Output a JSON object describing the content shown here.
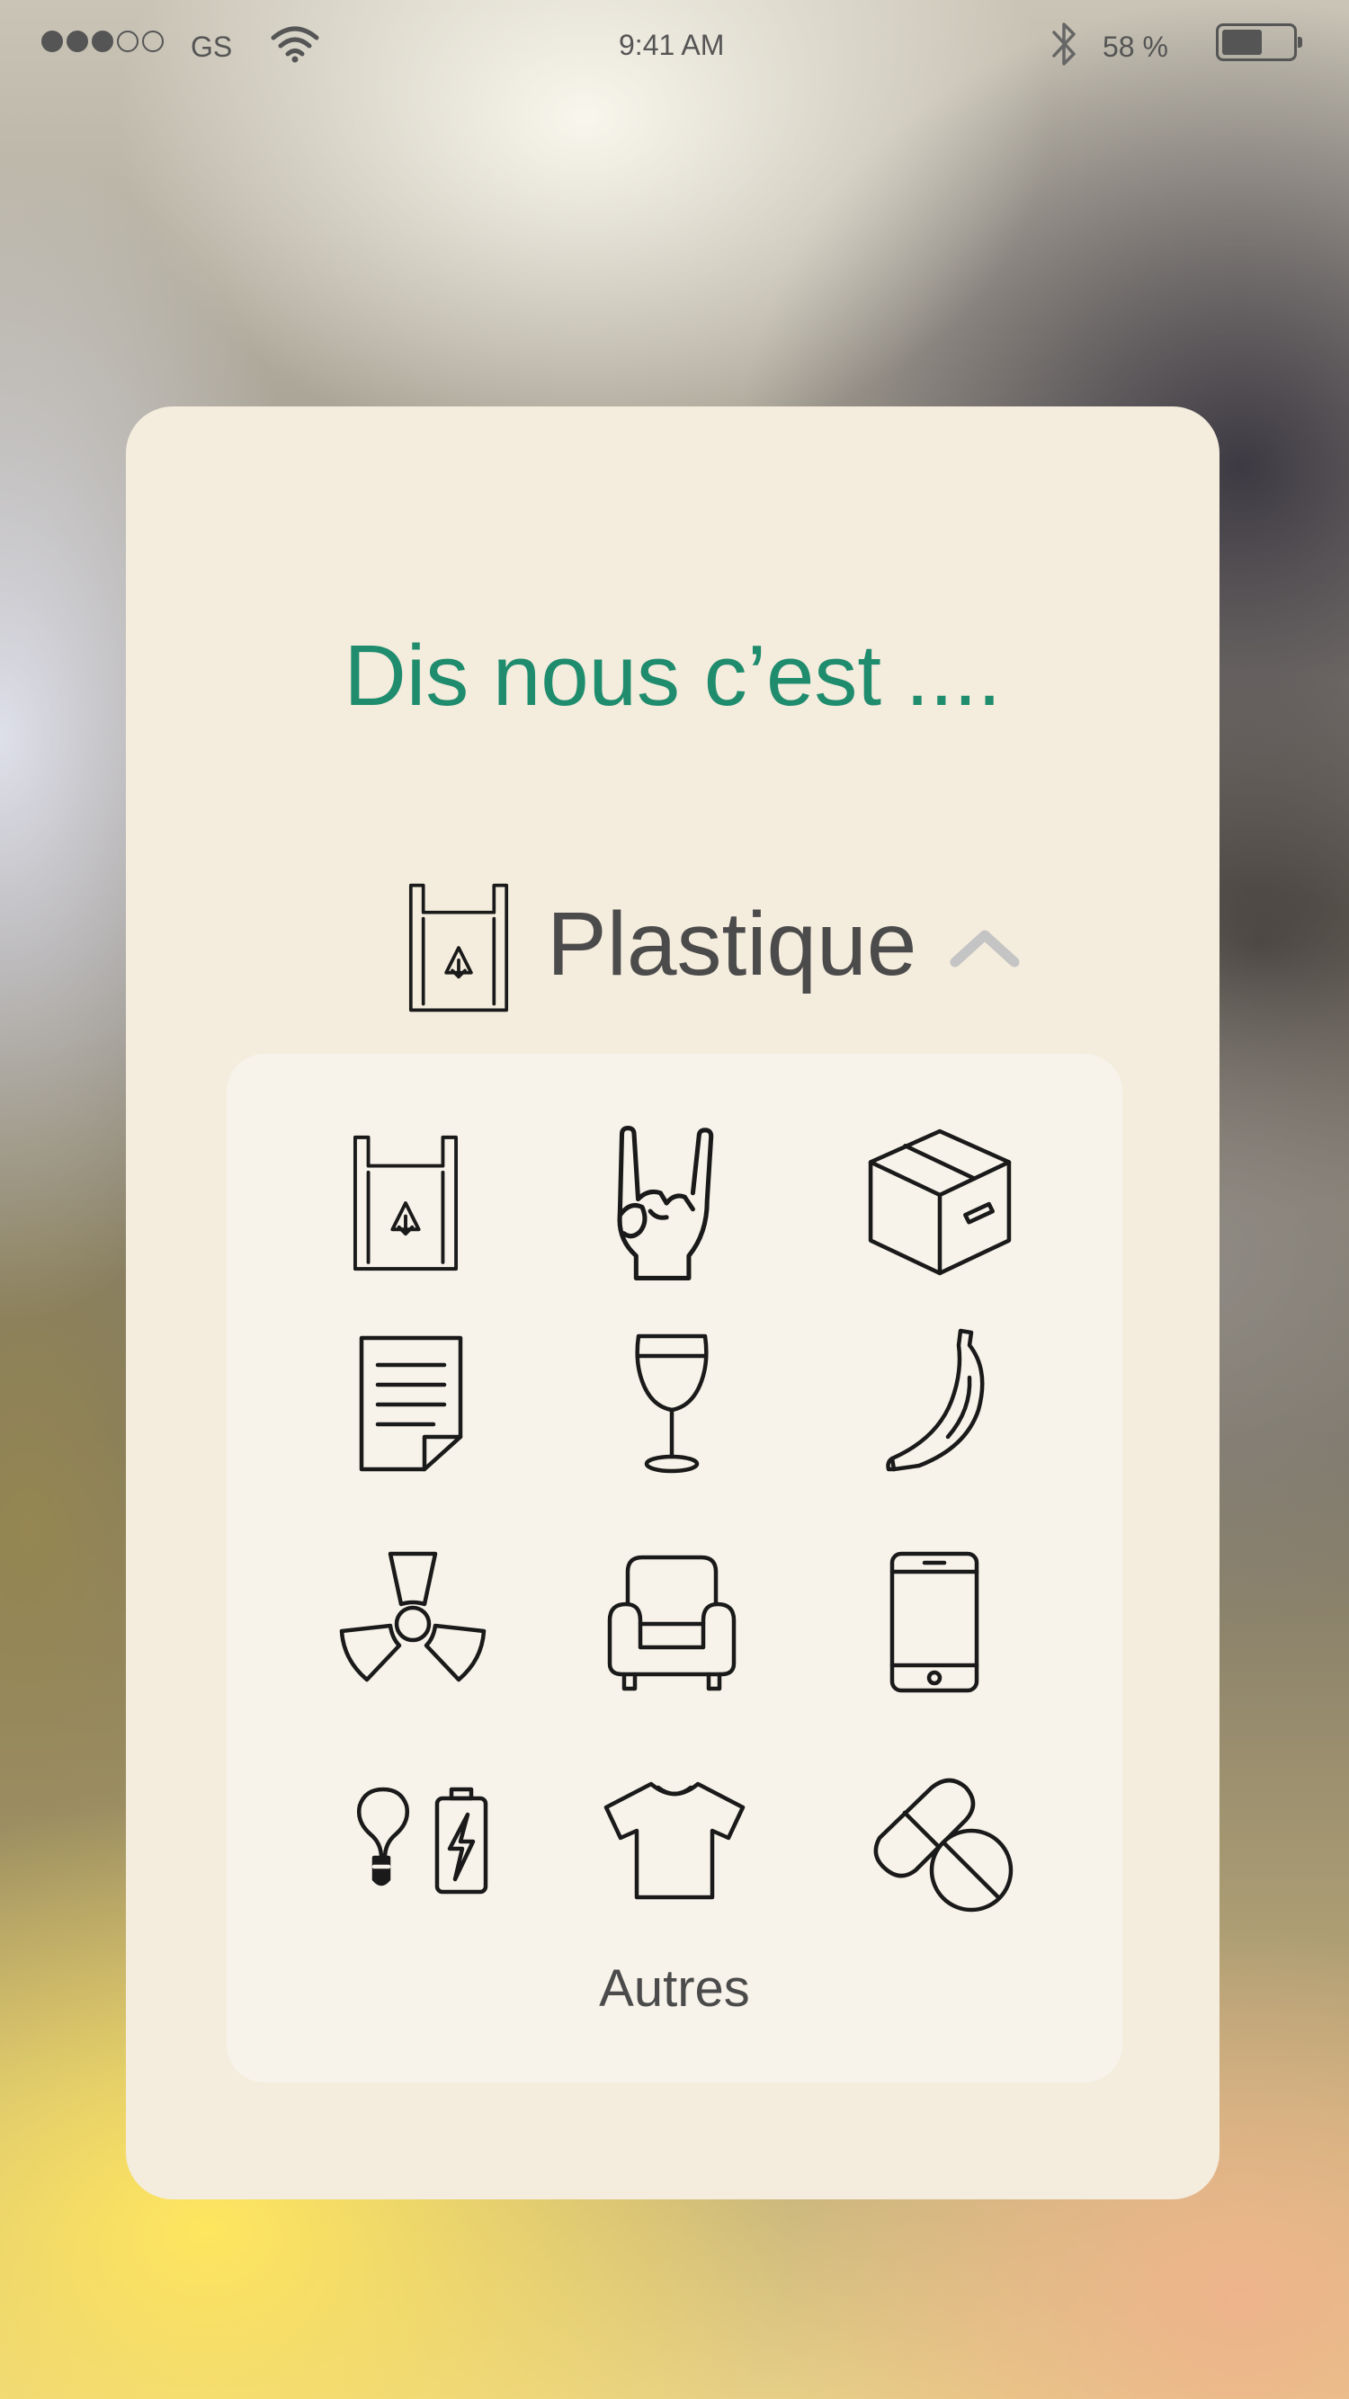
{
  "status_bar": {
    "carrier": "GS",
    "time": "9:41 AM",
    "battery_percent_label": "58 %",
    "battery_level": 0.58,
    "signal_bars_filled": 3,
    "signal_bars_total": 5
  },
  "dialog": {
    "title": "Dis nous c’est ....",
    "selected_category": {
      "label": "Plastique",
      "icon": "plastic-bag-icon"
    },
    "collapse_icon": "chevron-up-icon",
    "options": [
      {
        "icon": "plastic-bag-icon"
      },
      {
        "icon": "rock-hand-icon"
      },
      {
        "icon": "cardboard-box-icon"
      },
      {
        "icon": "paper-document-icon"
      },
      {
        "icon": "wine-glass-icon"
      },
      {
        "icon": "banana-icon"
      },
      {
        "icon": "radioactive-icon"
      },
      {
        "icon": "armchair-icon"
      },
      {
        "icon": "smartphone-icon"
      },
      {
        "icon": "bulb-battery-icon"
      },
      {
        "icon": "t-shirt-icon"
      },
      {
        "icon": "pills-icon"
      }
    ],
    "other_label": "Autres"
  },
  "colors": {
    "title_green": "#1f8c6e",
    "card_bg": "#f4ecdd",
    "panel_bg": "#f7f3ea",
    "text_dark": "#4b4b4b"
  }
}
